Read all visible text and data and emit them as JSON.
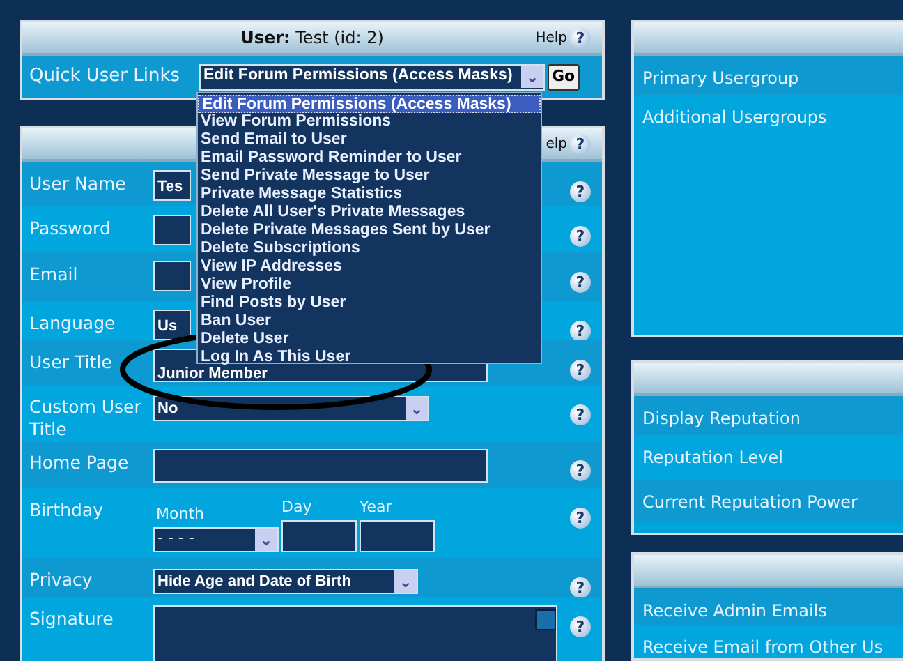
{
  "user_panel": {
    "title_label": "User:",
    "title_value": "Test (id: 2)",
    "help": "Help",
    "help_glyph": "?",
    "quick_links": {
      "label": "Quick User Links",
      "value": "Edit Forum Permissions (Access Masks)",
      "arrow": "⌄",
      "button": "Go",
      "expanded": true,
      "options": [
        {
          "label": "Edit Forum Permissions (Access Masks)",
          "selected": true
        },
        {
          "label": "View Forum Permissions",
          "selected": false
        },
        {
          "label": "Send Email to User",
          "selected": false
        },
        {
          "label": "Email Password Reminder to User",
          "selected": false
        },
        {
          "label": "Send Private Message to User",
          "selected": false
        },
        {
          "label": "Private Message Statistics",
          "selected": false
        },
        {
          "label": "Delete All User's Private Messages",
          "selected": false
        },
        {
          "label": "Delete Private Messages Sent by User",
          "selected": false
        },
        {
          "label": "Delete Subscriptions",
          "selected": false
        },
        {
          "label": "View IP Addresses",
          "selected": false
        },
        {
          "label": "View Profile",
          "selected": false
        },
        {
          "label": "Find Posts by User",
          "selected": false
        },
        {
          "label": "Ban User",
          "selected": false
        },
        {
          "label": "Delete User",
          "selected": false
        },
        {
          "label": "Log In As This User",
          "selected": false
        }
      ]
    }
  },
  "profile_panel": {
    "help": "elp",
    "help_glyph": "?",
    "rows": [
      {
        "kind": "text",
        "label": "User Name",
        "value": "Tes",
        "covered": true,
        "help": "?"
      },
      {
        "kind": "text",
        "label": "Password",
        "covered": true,
        "help": "?"
      },
      {
        "kind": "text",
        "label": "Email",
        "covered": true,
        "help": "?"
      },
      {
        "kind": "text",
        "label": "Language",
        "value": "Us",
        "covered": true,
        "help": "?"
      },
      {
        "kind": "text",
        "label": "User Title",
        "value": "Junior Member",
        "help": "?"
      },
      {
        "kind": "select",
        "label": "Custom User Title",
        "value": "No",
        "arrow": "⌄",
        "help": "?"
      },
      {
        "kind": "text",
        "label": "Home Page",
        "help": "?"
      },
      {
        "kind": "birthday",
        "label": "Birthday",
        "month_label": "Month",
        "month_value": "- - - -",
        "arrow": "⌄",
        "day_label": "Day",
        "year_label": "Year",
        "help": "?"
      },
      {
        "kind": "select",
        "label": "Privacy",
        "value": "Hide Age and Date of Birth",
        "arrow": "⌄",
        "help": "?"
      },
      {
        "kind": "textarea",
        "label": "Signature",
        "help": "?"
      }
    ]
  },
  "usergroups_panel": {
    "rows": [
      {
        "label": "Primary Usergroup"
      },
      {
        "label": "Additional Usergroups"
      }
    ]
  },
  "reputation_panel": {
    "rows": [
      {
        "label": "Display Reputation"
      },
      {
        "label": "Reputation Level"
      },
      {
        "label": "Current Reputation Power"
      }
    ]
  },
  "email_panel": {
    "rows": [
      {
        "label": "Receive Admin Emails"
      },
      {
        "label": "Receive Email from Other Us"
      }
    ]
  }
}
